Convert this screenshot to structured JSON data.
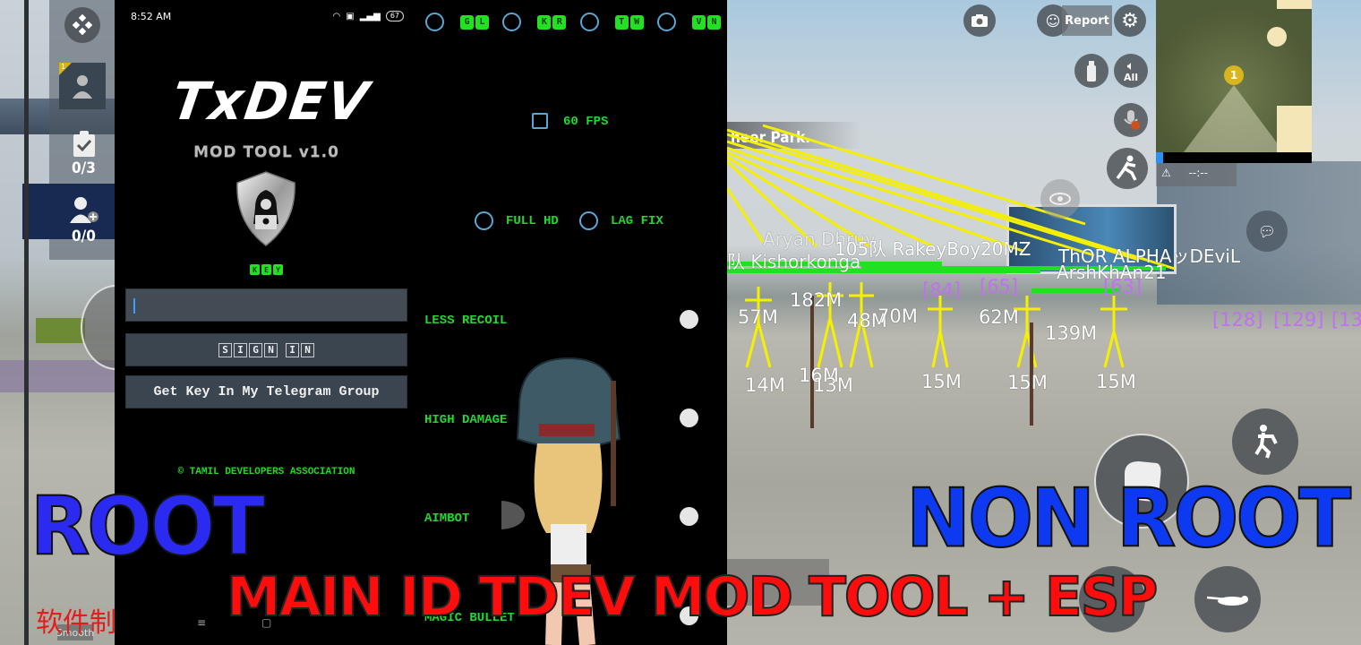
{
  "phone": {
    "status_time": "8:52 AM",
    "battery": "67",
    "logo_title": "TxDEV",
    "subtitle": "MOD TOOL v1.0",
    "key_label_letters": [
      "K",
      "E",
      "Y"
    ],
    "key_input_value": "",
    "key_input_placeholder": "",
    "signin_letters": [
      "S",
      "I",
      "G",
      "N",
      " ",
      "I",
      "N"
    ],
    "telegram_button": "Get Key In My Telegram Group",
    "copyright": "© TAMIL DEVELOPERS ASSOCIATION",
    "nav": {
      "menu": "≡",
      "home": "▢"
    }
  },
  "menu": {
    "regions": [
      {
        "code": [
          "G",
          "L"
        ],
        "selected": false
      },
      {
        "code": [
          "K",
          "R"
        ],
        "selected": false
      },
      {
        "code": [
          "T",
          "W"
        ],
        "selected": false
      },
      {
        "code": [
          "V",
          "N"
        ],
        "selected": false
      }
    ],
    "fps_60": {
      "label": "60 FPS",
      "checked": false
    },
    "full_hd": {
      "label": "FULL HD",
      "selected": false
    },
    "lag_fix": {
      "label": "LAG FIX",
      "selected": false
    },
    "toggles": [
      {
        "label": "LESS RECOIL",
        "on": false
      },
      {
        "label": "HIGH DAMAGE",
        "on": false
      },
      {
        "label": "AIMBOT",
        "on": false
      },
      {
        "label": "MAGIC BULLET",
        "on": false
      }
    ]
  },
  "game_left": {
    "tasks_count": "0/3",
    "team_count": "0/0",
    "rank_badge": "1",
    "chinese_text": "软件制",
    "smooth_label": "Smooth"
  },
  "game_right": {
    "location_label": "heer Park.",
    "report_label": "Report",
    "voice_label": "All",
    "minimap_marker": "1",
    "warning_text": "--:--",
    "esp_names": [
      "Aryan Dhruv",
      "105队 RakeyBoy20MZ",
      "队 Kishorkonga",
      "ThOR ALPHAッDEviL",
      "ArshKhAn21"
    ],
    "esp_distances": [
      "57M",
      "182M",
      "48M",
      "70M",
      "62M",
      "139M",
      "14M",
      "16M",
      "13M",
      "15M",
      "15M",
      "15M"
    ],
    "esp_ids": [
      "[84]",
      "[65]",
      "[63]",
      "[128]",
      "[129]",
      "[13"
    ]
  },
  "overlay": {
    "root_label": "ROOT",
    "non_root_label": "NON ROOT",
    "headline": "MAIN ID TDEV MOD TOOL + ESP"
  },
  "colors": {
    "accent_green": "#22e022",
    "radio_blue": "#5aa6d4",
    "headline_red": "#ff0d0d",
    "title_blue": "#2a2af0",
    "esp_yellow": "#f5f000",
    "esp_purple": "#c070f0"
  }
}
